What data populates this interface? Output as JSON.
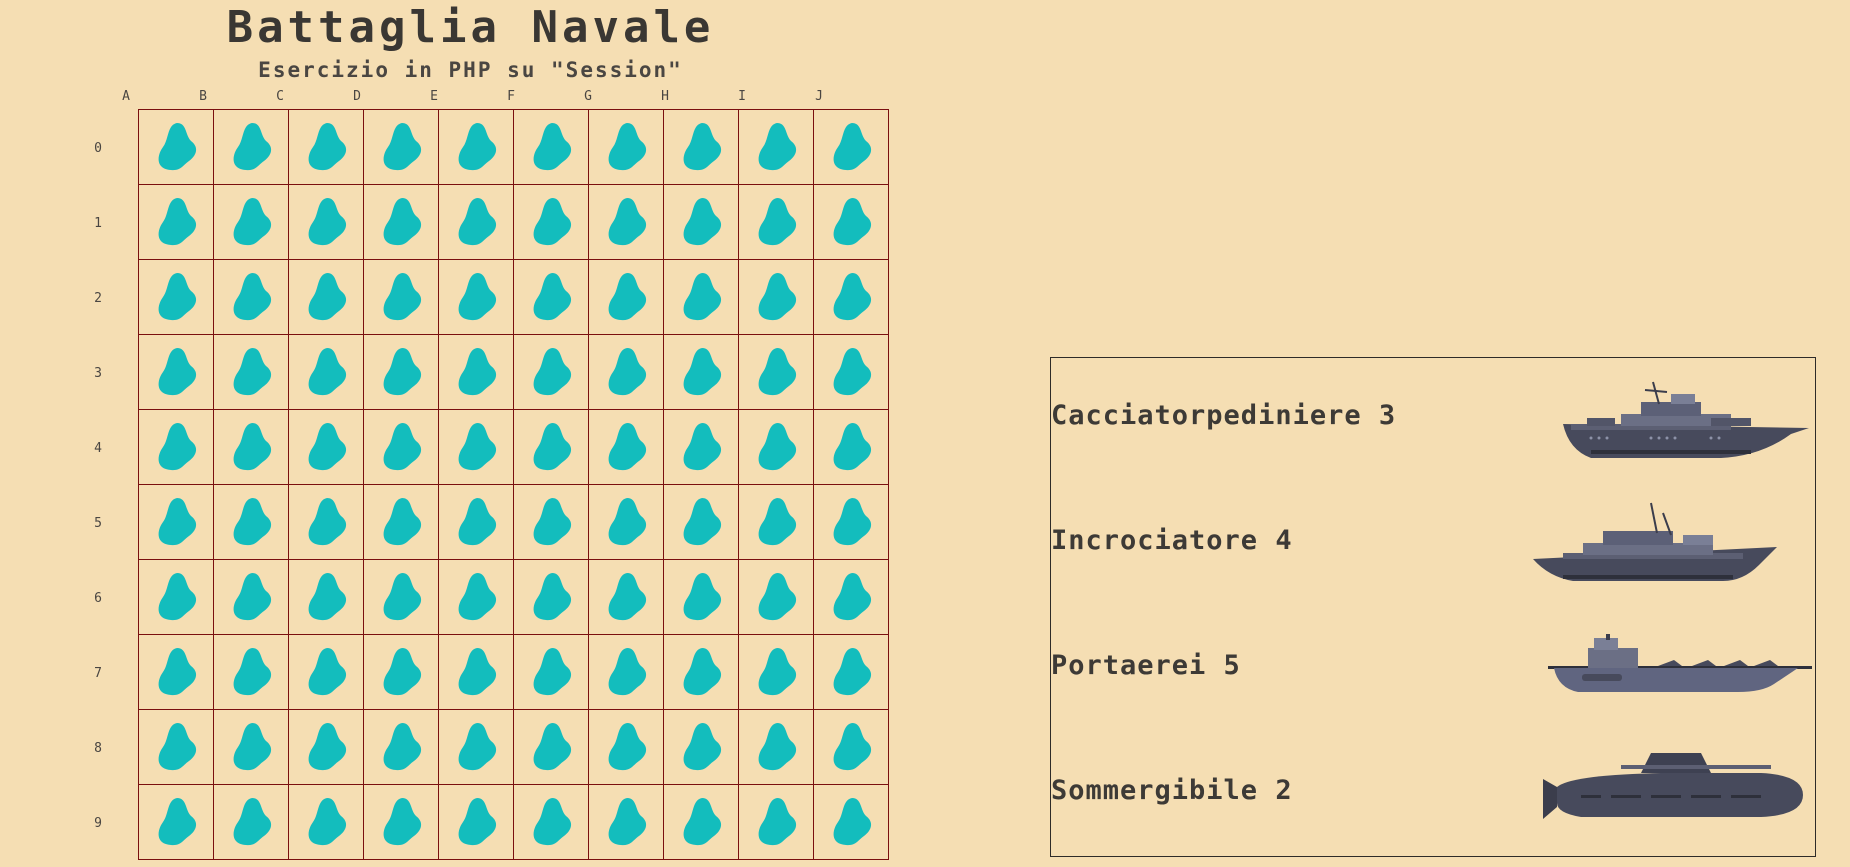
{
  "header": {
    "title": "Battaglia Navale",
    "subtitle": "Esercizio in PHP su \"Session\""
  },
  "board": {
    "columns": [
      "A",
      "B",
      "C",
      "D",
      "E",
      "F",
      "G",
      "H",
      "I",
      "J"
    ],
    "rows": [
      "0",
      "1",
      "2",
      "3",
      "4",
      "5",
      "6",
      "7",
      "8",
      "9"
    ],
    "cell_state": "water",
    "cell_icon": "water-drop-icon",
    "colors": {
      "water": "#13bdbd",
      "grid_line": "#7a0f0f",
      "background": "#f5deb3"
    }
  },
  "fleet": {
    "ships": [
      {
        "label": "Cacciatorpediniere 3",
        "icon": "destroyer-ship-icon"
      },
      {
        "label": "Incrociatore 4",
        "icon": "cruiser-ship-icon"
      },
      {
        "label": "Portaerei 5",
        "icon": "aircraft-carrier-icon"
      },
      {
        "label": "Sommergibile 2",
        "icon": "submarine-icon"
      }
    ]
  }
}
